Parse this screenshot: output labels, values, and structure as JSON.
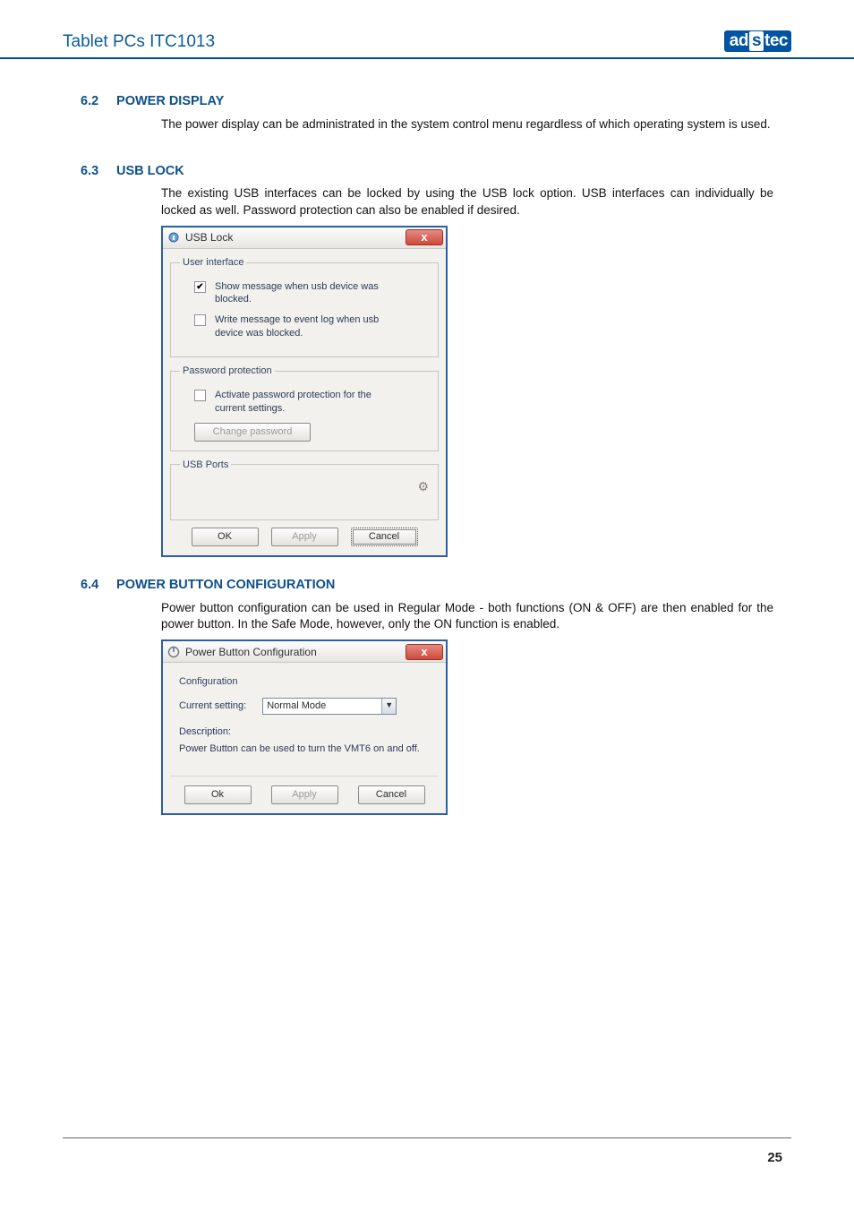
{
  "header": {
    "title": "Tablet PCs ITC1013",
    "logo_text_left": "ad",
    "logo_text_mid": "s",
    "logo_text_right": "tec"
  },
  "sections": {
    "s62": {
      "num": "6.2",
      "title": "POWER DISPLAY",
      "body": "The power display can be administrated in the system control menu regardless of which operating system is used."
    },
    "s63": {
      "num": "6.3",
      "title": "USB LOCK",
      "body": "The existing USB interfaces can be locked by using the USB lock option. USB interfaces can individually be locked as well. Password protection can also be enabled if desired."
    },
    "s64": {
      "num": "6.4",
      "title": "POWER BUTTON CONFIGURATION",
      "body": "Power button configuration can be used in Regular Mode - both functions (ON & OFF) are then enabled for the power button. In the Safe Mode, however, only the ON function is enabled."
    }
  },
  "dlg_usb": {
    "title": "USB Lock",
    "close": "x",
    "group_ui": "User interface",
    "chk1_label": "Show message when usb device was blocked.",
    "chk2_label": "Write message to event log when usb device was blocked.",
    "group_pw": "Password protection",
    "chk3_label": "Activate password protection for the current settings.",
    "btn_changepw": "Change password",
    "group_ports": "USB Ports",
    "btn_ok": "OK",
    "btn_apply": "Apply",
    "btn_cancel": "Cancel"
  },
  "dlg_pbc": {
    "title": "Power Button Configuration",
    "close": "x",
    "group_cfg": "Configuration",
    "lbl_current": "Current setting:",
    "combo_value": "Normal Mode",
    "lbl_desc": "Description:",
    "desc_text": "Power Button can be used to turn the VMT6 on and off.",
    "btn_ok": "Ok",
    "btn_apply": "Apply",
    "btn_cancel": "Cancel"
  },
  "page_number": "25"
}
